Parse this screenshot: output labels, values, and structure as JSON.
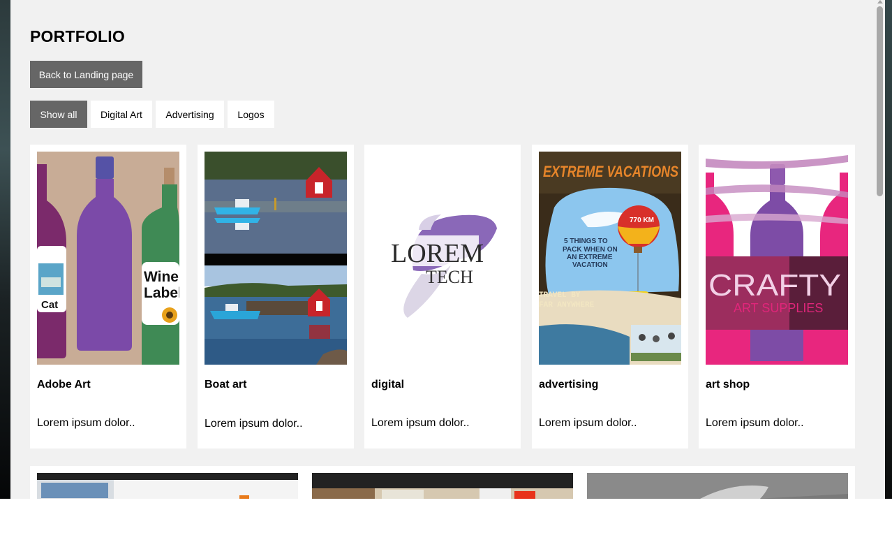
{
  "page": {
    "title": "PORTFOLIO",
    "back_button": "Back to Landing page"
  },
  "filters": [
    "Show all",
    "Digital Art",
    "Advertising",
    "Logos"
  ],
  "active_filter": "Show all",
  "cards": [
    {
      "title": "Adobe Art",
      "description": "Lorem ipsum dolor..",
      "image_text": [
        "Wine",
        "Label",
        "Cat"
      ]
    },
    {
      "title": "Boat art",
      "description": "Lorem ipsum dolor.."
    },
    {
      "title": "digital",
      "description": "Lorem ipsum dolor..",
      "image_text": [
        "LOREM",
        "TECH"
      ]
    },
    {
      "title": "advertising",
      "description": "Lorem ipsum dolor..",
      "image_text": [
        "EXTREME VACATIONS",
        "5 THINGS TO",
        "PACK WHEN ON",
        "AN EXTREME",
        "VACATION",
        "TRAVEL BY",
        "FAR ANYWHERE",
        "770 KM"
      ]
    },
    {
      "title": "art shop",
      "description": "Lorem ipsum dolor..",
      "image_text": [
        "CRAFTY",
        "ART SUPPLIES"
      ]
    }
  ],
  "colors": {
    "page_bg": "#f1f1f1",
    "button_bg": "#666666",
    "card_bg": "#ffffff"
  }
}
